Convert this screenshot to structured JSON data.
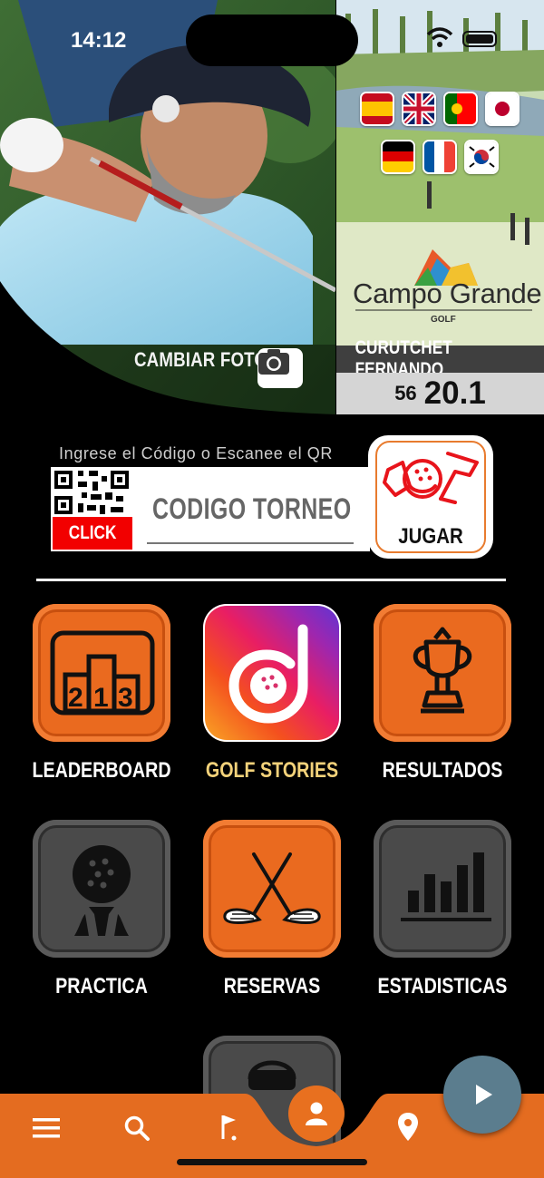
{
  "status_bar": {
    "time": "14:12"
  },
  "header": {
    "change_photo_label": "CAMBIAR FOTO"
  },
  "club_panel": {
    "flags": [
      "spain-flag",
      "uk-flag",
      "portugal-flag",
      "japan-flag",
      "germany-flag",
      "france-flag",
      "korea-flag"
    ],
    "club_name": "Campo Grande",
    "club_subtitle": "GOLF",
    "player_name": "CURUTCHET FERNANDO",
    "player_number": "56",
    "player_handicap": "20.1"
  },
  "code_entry": {
    "hint": "Ingrese el Código o Escanee el QR",
    "qr_click_label": "CLICK",
    "code_placeholder": "CODIGO TORNEO",
    "play_label": "JUGAR"
  },
  "menu": {
    "items": [
      {
        "label": "LEADERBOARD",
        "icon": "podium-icon",
        "style": "orange",
        "label_color": "#ffffff"
      },
      {
        "label": "GOLF STORIES",
        "icon": "golf-stories-icon",
        "style": "instagram-gradient",
        "label_color": "#f3d27a"
      },
      {
        "label": "RESULTADOS",
        "icon": "trophy-icon",
        "style": "orange",
        "label_color": "#ffffff"
      },
      {
        "label": "PRACTICA",
        "icon": "golf-ball-tee-icon",
        "style": "gray",
        "label_color": "#ffffff"
      },
      {
        "label": "RESERVAS",
        "icon": "crossed-clubs-icon",
        "style": "orange",
        "label_color": "#ffffff"
      },
      {
        "label": "ESTADISTICAS",
        "icon": "bar-chart-icon",
        "style": "gray",
        "label_color": "#ffffff"
      }
    ]
  },
  "bottom_nav": {
    "items": [
      "menu-icon",
      "search-icon",
      "golf-flag-icon",
      "profile-icon",
      "location-pin-icon"
    ],
    "fab_icon": "play-icon"
  },
  "colors": {
    "accent_orange": "#ea6a1f",
    "tile_gray": "#4a4a4a",
    "click_red": "#f20000",
    "fab_blue": "#5b7d8e"
  }
}
